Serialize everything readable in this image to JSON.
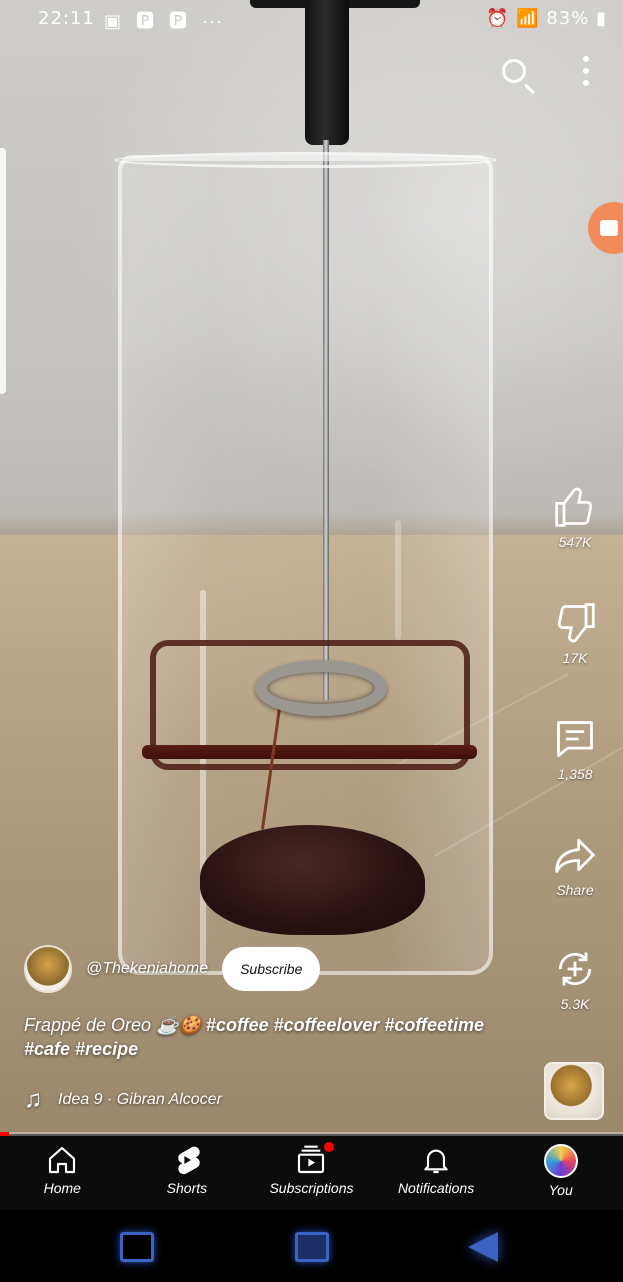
{
  "status_bar": {
    "time": "22:11",
    "more": "···",
    "battery": "83%"
  },
  "video": {
    "channel_handle": "@Thekeniahome",
    "subscribe_label": "Subscribe",
    "title_plain": "Frappé de Oreo ☕️🍪",
    "title_tags_1": "#coffee #coffeelover #coffeetime",
    "title_tags_2": "#cafe #recipe",
    "music": "Idea 9 · Gibran Alcocer",
    "progress_fraction": 0.015
  },
  "actions": {
    "likes": "547K",
    "dislikes": "17K",
    "comments": "1,358",
    "share": "Share",
    "remix": "5.3K"
  },
  "nav": {
    "home": "Home",
    "shorts": "Shorts",
    "subscriptions": "Subscriptions",
    "notifications": "Notifications",
    "you": "You"
  },
  "colors": {
    "progress_red": "#ff0000",
    "nav_bg": "#0c0c0c",
    "system_nav_blue": "#3b63c4"
  }
}
